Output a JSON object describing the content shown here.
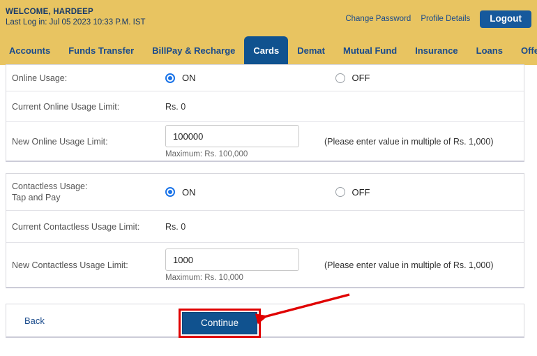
{
  "header": {
    "welcome": "WELCOME, HARDEEP",
    "last_login": "Last Log in: Jul 05 2023 10:33 P.M. IST",
    "links": [
      {
        "label": "Change Password",
        "name": "change-password-link"
      },
      {
        "label": "Profile Details",
        "name": "profile-details-link"
      }
    ],
    "logout_label": "Logout",
    "band_color": "#e8c461",
    "brand_blue": "#10528f"
  },
  "nav": {
    "tabs": [
      {
        "label": "Accounts",
        "active": false
      },
      {
        "label": "Funds Transfer",
        "active": false
      },
      {
        "label": "BillPay & Recharge",
        "active": false
      },
      {
        "label": "Cards",
        "active": true
      },
      {
        "label": "Demat",
        "active": false
      },
      {
        "label": "Mutual Fund",
        "active": false
      },
      {
        "label": "Insurance",
        "active": false
      },
      {
        "label": "Loans",
        "active": false
      },
      {
        "label": "Offers",
        "active": false
      }
    ]
  },
  "online_section": {
    "usage_label": "Online Usage:",
    "on_label": "ON",
    "off_label": "OFF",
    "selected": "ON",
    "current_limit_label": "Current Online Usage Limit:",
    "current_limit_value": "Rs. 0",
    "new_limit_label": "New Online Usage Limit:",
    "new_limit_value": "100000",
    "maximum_note": "Maximum: Rs. 100,000",
    "hint": "(Please enter value in multiple of Rs. 1,000)"
  },
  "contactless_section": {
    "usage_label_line1": "Contactless Usage:",
    "usage_label_line2": "Tap and Pay",
    "on_label": "ON",
    "off_label": "OFF",
    "selected": "ON",
    "current_limit_label": "Current Contactless Usage Limit:",
    "current_limit_value": "Rs. 0",
    "new_limit_label": "New Contactless Usage Limit:",
    "new_limit_value": "1000",
    "maximum_note": "Maximum: Rs. 10,000",
    "hint": "(Please enter value in multiple of Rs. 1,000)"
  },
  "footer": {
    "back_label": "Back",
    "continue_label": "Continue",
    "highlight_color": "#e00000",
    "annotation": "red-arrow-pointing-to-continue"
  }
}
